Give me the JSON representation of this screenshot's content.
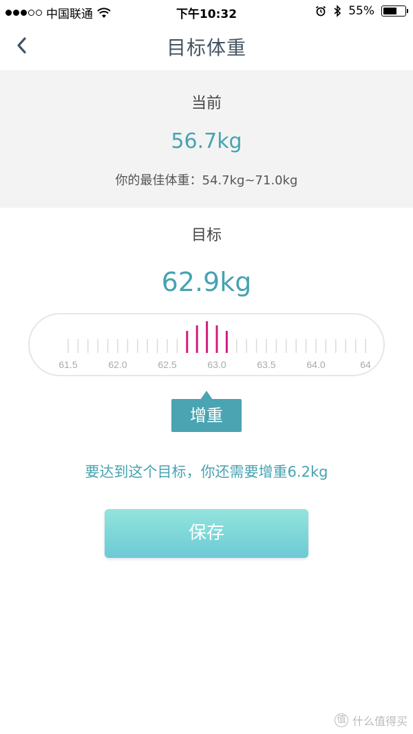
{
  "status_bar": {
    "carrier": "中国联通",
    "time": "下午10:32",
    "battery_pct": "55%",
    "signal_bars_filled": 3,
    "signal_bars_total": 5
  },
  "nav": {
    "title": "目标体重",
    "back_icon": "chevron-left-icon"
  },
  "current": {
    "label": "当前",
    "value": "56.7kg",
    "best_range": "你的最佳体重：54.7kg~71.0kg"
  },
  "target": {
    "label": "目标",
    "value": "62.9kg"
  },
  "ruler": {
    "tick_labels": [
      "61.5",
      "62.0",
      "62.5",
      "63.0",
      "63.5",
      "64.0",
      "64"
    ],
    "selected": 62.9,
    "step": 0.1,
    "colors": {
      "tick": "#dadada",
      "active": "#d21b7e",
      "label": "#aaaaaa"
    }
  },
  "badge": {
    "label": "增重"
  },
  "hint": "要达到这个目标，你还需要增重6.2kg",
  "save_button": {
    "label": "保存"
  },
  "watermark": {
    "text": "什么值得买",
    "icon_text": "值"
  },
  "colors": {
    "accent": "#46a3b1",
    "badge": "#4aa4b2"
  }
}
